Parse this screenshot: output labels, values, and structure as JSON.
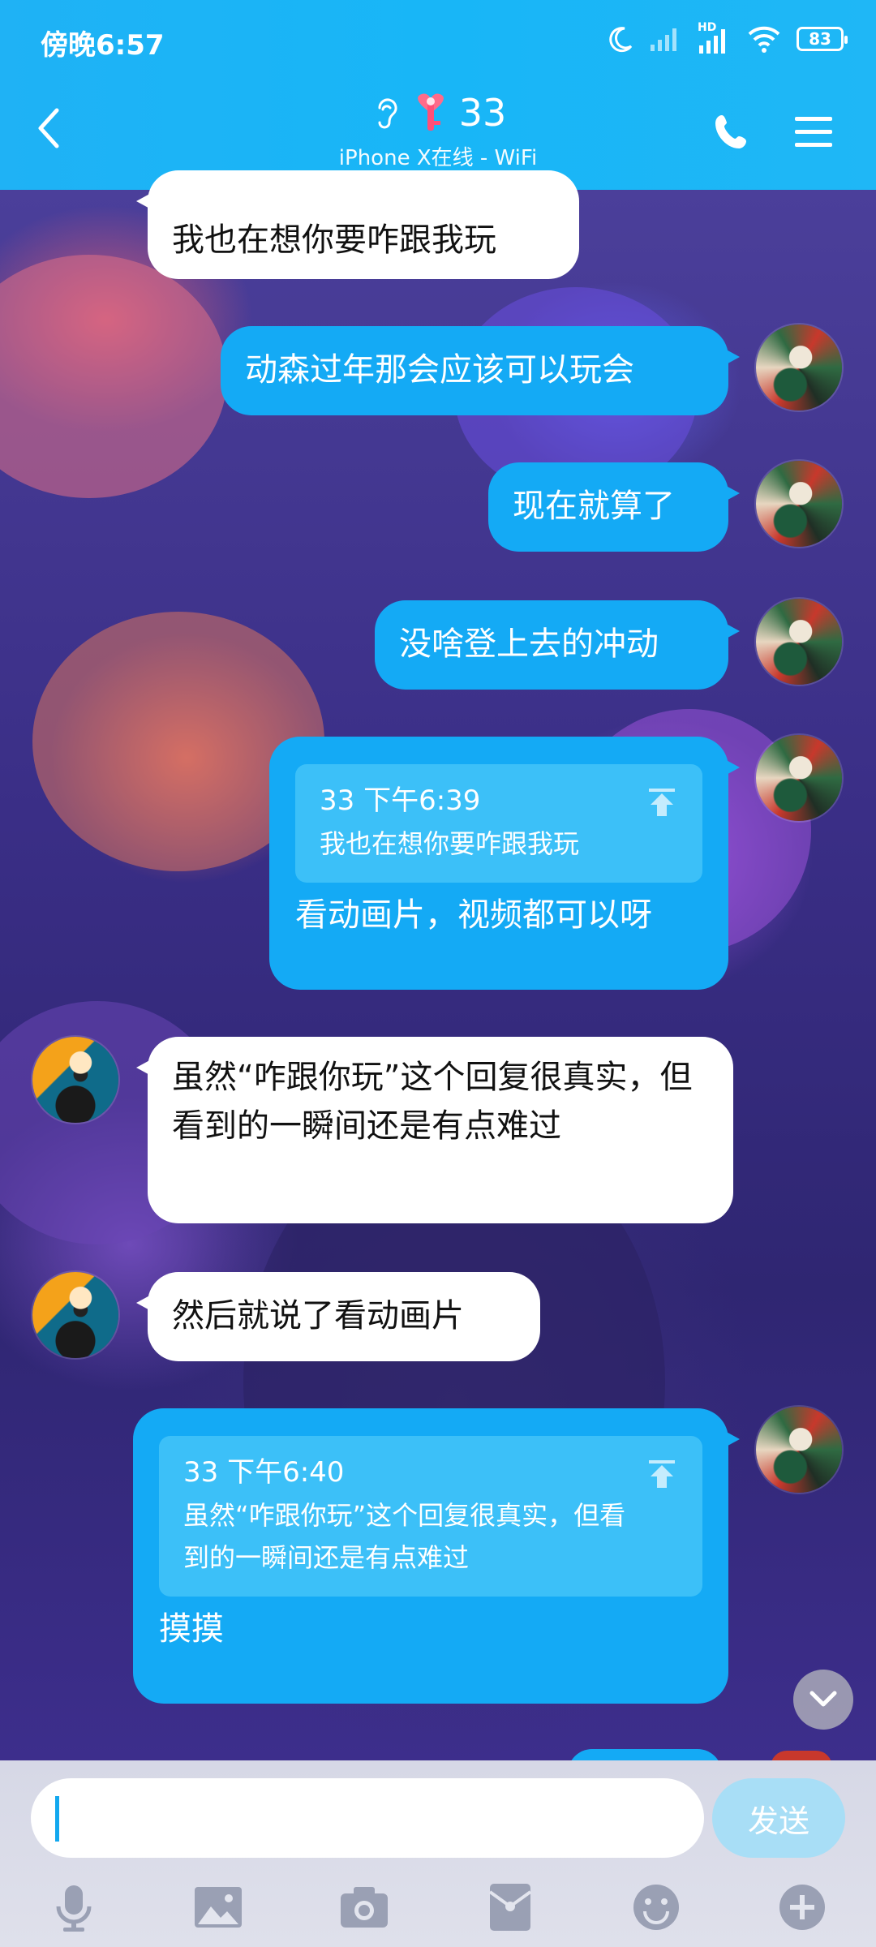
{
  "status_bar": {
    "time": "傍晚6:57",
    "battery": "83",
    "hd_label": "HD"
  },
  "header": {
    "name": "33",
    "device_status": "iPhone X在线 - WiFi"
  },
  "messages": [
    {
      "side": "left",
      "text": "我也在想你要咋跟我玩"
    },
    {
      "side": "right",
      "text": "动森过年那会应该可以玩会"
    },
    {
      "side": "right",
      "text": "现在就算了"
    },
    {
      "side": "right",
      "text": "没啥登上去的冲动"
    },
    {
      "side": "right",
      "quote_head": "33 下午6:39",
      "quote_body": "我也在想你要咋跟我玩",
      "text": "看动画片，视频都可以呀"
    },
    {
      "side": "left",
      "text": "虽然“咋跟你玩”这个回复很真实，但看到的一瞬间还是有点难过"
    },
    {
      "side": "left",
      "text": "然后就说了看动画片"
    },
    {
      "side": "right",
      "quote_head": "33 下午6:40",
      "quote_body": "虽然“咋跟你玩”这个回复很真实，但看到的一瞬间还是有点难过",
      "text": "摸摸"
    }
  ],
  "composer": {
    "input_value": "",
    "send_label": "发送"
  },
  "toolbar_icons": [
    "mic-icon",
    "image-icon",
    "camera-icon",
    "red-packet-icon",
    "emoji-icon",
    "plus-icon"
  ],
  "colors": {
    "header": "#1fb2f5",
    "bubble_right": "#14aaf5",
    "bubble_left": "#ffffff",
    "quote_bg": "#3cc0f8"
  }
}
